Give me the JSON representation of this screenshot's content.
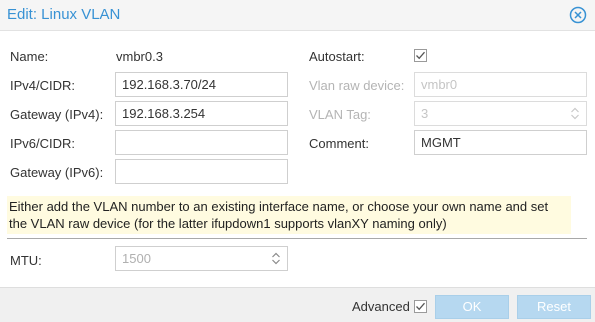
{
  "dialog": {
    "title": "Edit: Linux VLAN"
  },
  "form": {
    "name": {
      "label": "Name:",
      "value": "vmbr0.3"
    },
    "ipv4": {
      "label": "IPv4/CIDR:",
      "value": "192.168.3.70/24"
    },
    "gateway4": {
      "label": "Gateway (IPv4):",
      "value": "192.168.3.254"
    },
    "ipv6": {
      "label": "IPv6/CIDR:",
      "value": ""
    },
    "gateway6": {
      "label": "Gateway (IPv6):",
      "value": ""
    },
    "autostart": {
      "label": "Autostart:",
      "checked": true
    },
    "vlan_raw_device": {
      "label": "Vlan raw device:",
      "value": "vmbr0",
      "disabled": true
    },
    "vlan_tag": {
      "label": "VLAN Tag:",
      "value": "3",
      "disabled": true
    },
    "comment": {
      "label": "Comment:",
      "value": "MGMT"
    },
    "notice": "Either add the VLAN number to an existing interface name, or choose your own name and set the VLAN raw device (for the latter ifupdown1 supports vlanXY naming only)",
    "mtu": {
      "label": "MTU:",
      "placeholder": "1500"
    }
  },
  "footer": {
    "advanced_label": "Advanced",
    "advanced_checked": true,
    "ok_label": "OK",
    "reset_label": "Reset"
  },
  "icons": {
    "close": "close-circle-icon",
    "checkbox": "checkmark-icon",
    "spinner": "spinner-arrows-icon"
  },
  "colors": {
    "title": "#3892d4",
    "button": "#b6d8f0",
    "notice_bg": "#fffbe0"
  }
}
